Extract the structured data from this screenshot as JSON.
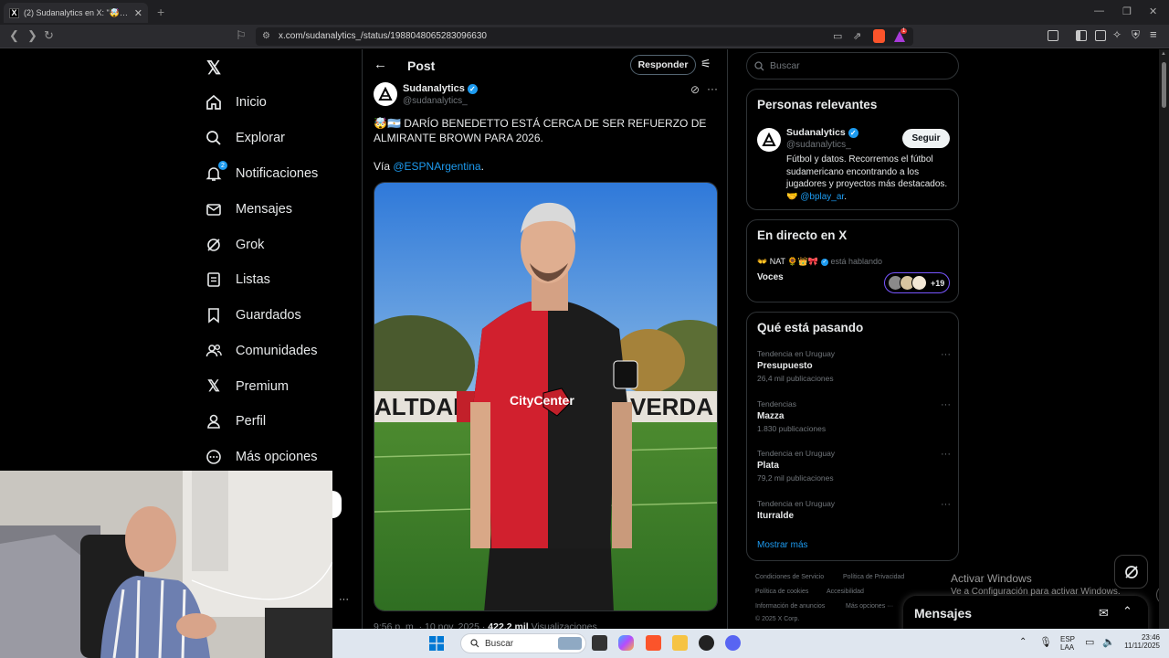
{
  "browser": {
    "tab_title": "(2) Sudanalytics en X: \"🤯🇦🇷 DARÍO BENEDETTO",
    "tab_close": "✕",
    "new_tab": "+",
    "url": "x.com/sudanalytics_/status/1988048065283096630",
    "brave_badge": "1"
  },
  "nav": {
    "logo": "𝕏",
    "items": [
      {
        "label": "Inicio",
        "icon": "home-icon"
      },
      {
        "label": "Explorar",
        "icon": "search-icon"
      },
      {
        "label": "Notificaciones",
        "icon": "bell-icon",
        "badge": "2"
      },
      {
        "label": "Mensajes",
        "icon": "mail-icon"
      },
      {
        "label": "Grok",
        "icon": "grok-icon"
      },
      {
        "label": "Listas",
        "icon": "list-icon"
      },
      {
        "label": "Guardados",
        "icon": "bookmark-icon"
      },
      {
        "label": "Comunidades",
        "icon": "people-icon"
      },
      {
        "label": "Premium",
        "icon": "x-icon"
      },
      {
        "label": "Perfil",
        "icon": "person-icon"
      },
      {
        "label": "Más opciones",
        "icon": "more-circle-icon"
      }
    ]
  },
  "post": {
    "header_title": "Post",
    "reply_label": "Responder",
    "author_name": "Sudanalytics",
    "author_handle": "@sudanalytics_",
    "text": "🤯🇦🇷 DARÍO BENEDETTO ESTÁ CERCA DE SER REFUERZO DE ALMIRANTE BROWN PARA 2026.",
    "via_prefix": "Vía ",
    "via_link": "@ESPNArgentina",
    "via_suffix": ".",
    "timestamp_prefix": "9:56 p. m. · 10 nov. 2025 · ",
    "views": "422,2 mil",
    "views_label": " Visualizaciones"
  },
  "search": {
    "placeholder": "Buscar"
  },
  "relevant": {
    "title": "Personas relevantes",
    "name": "Sudanalytics",
    "handle": "@sudanalytics_",
    "follow_label": "Seguir",
    "bio": "Fútbol y datos. Recorremos el fútbol sudamericano encontrando a los jugadores y proyectos más destacados. 🤝 ",
    "bio_link": "@bplay_ar",
    "bio_end": "."
  },
  "live": {
    "title": "En directo en X",
    "host": "👐 NAT 🌻👑🎀",
    "speaking": " está hablando",
    "space_title": "Voces",
    "count": "+19"
  },
  "trends": {
    "title": "Qué está pasando",
    "items": [
      {
        "context": "Tendencia en Uruguay",
        "name": "Presupuesto",
        "count": "26,4 mil publicaciones"
      },
      {
        "context": "Tendencias",
        "name": "Mazza",
        "count": "1.830 publicaciones"
      },
      {
        "context": "Tendencia en Uruguay",
        "name": "Plata",
        "count": "79,2 mil publicaciones"
      },
      {
        "context": "Tendencia en Uruguay",
        "name": "Iturralde",
        "count": ""
      }
    ],
    "show_more": "Mostrar más"
  },
  "footer": {
    "terms": "Condiciones de Servicio",
    "privacy": "Política de Privacidad",
    "cookies": "Política de cookies",
    "accessibility": "Accesibilidad",
    "ads": "Información de anuncios",
    "more": "Más opciones ···",
    "copyright": "© 2025 X Corp."
  },
  "windows_notice": {
    "line1": "Activar Windows",
    "line2": "Ve a Configuración para activar Windows."
  },
  "messages_drawer": {
    "title": "Mensajes"
  },
  "taskbar": {
    "search_placeholder": "Buscar",
    "lang": "ESP",
    "lang2": "LAA",
    "time": "23:46",
    "date": "11/11/2025"
  },
  "colors": {
    "accent": "#1d9bf0",
    "border": "#2f3336",
    "muted": "#71767b"
  }
}
